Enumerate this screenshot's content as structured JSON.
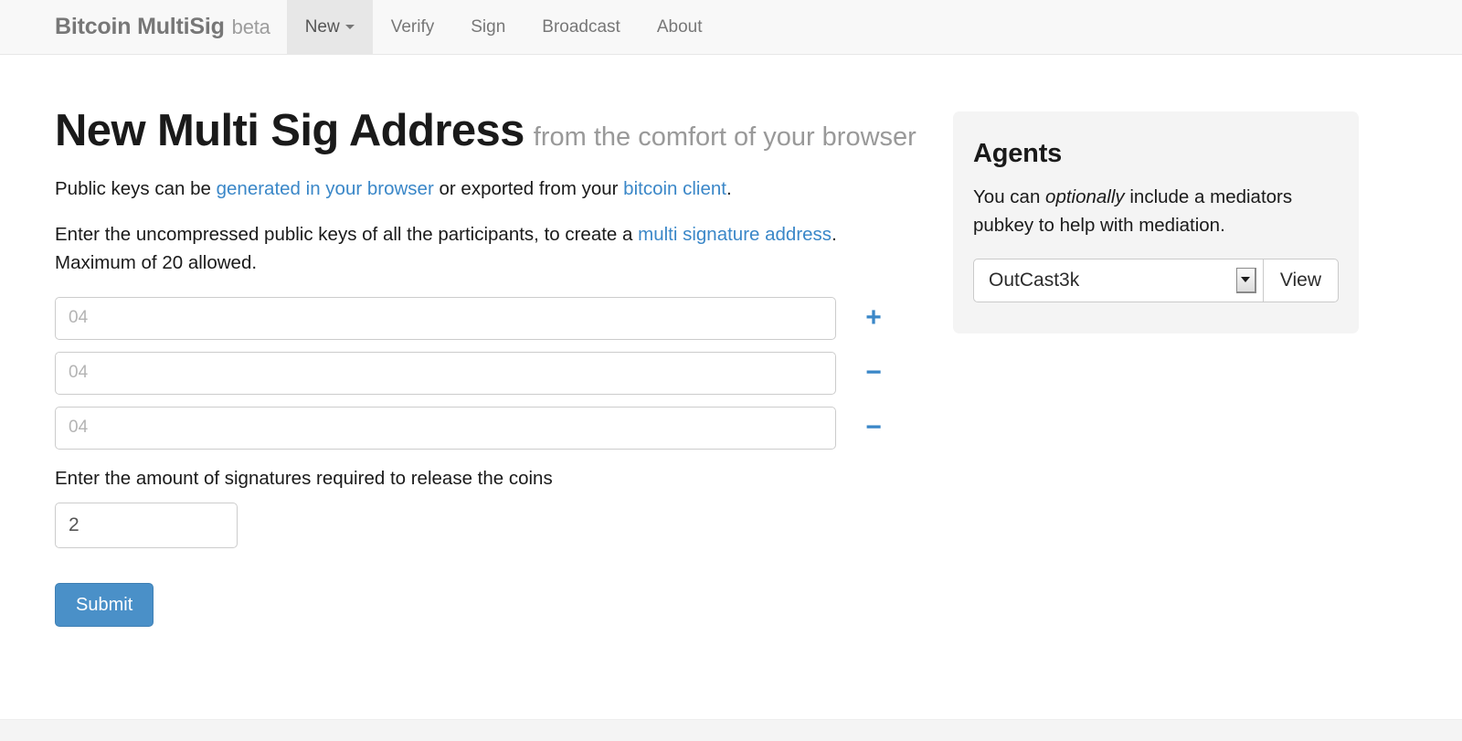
{
  "navbar": {
    "brand": {
      "name": "Bitcoin MultiSig",
      "tag": "beta"
    },
    "items": [
      {
        "label": "New",
        "active": true,
        "caret": true
      },
      {
        "label": "Verify",
        "active": false,
        "caret": false
      },
      {
        "label": "Sign",
        "active": false,
        "caret": false
      },
      {
        "label": "Broadcast",
        "active": false,
        "caret": false
      },
      {
        "label": "About",
        "active": false,
        "caret": false
      }
    ]
  },
  "main": {
    "heading": "New Multi Sig Address",
    "heading_sub": "from the comfort of your browser",
    "intro": {
      "part1": "Public keys can be ",
      "link1": "generated in your browser",
      "part2": " or exported from your ",
      "link2": "bitcoin client",
      "part3": "."
    },
    "instructions": {
      "part1": "Enter the uncompressed public keys of all the participants, to create a ",
      "link1": "multi signature address",
      "part2": ". Maximum of 20 allowed."
    },
    "key_rows": [
      {
        "value": "",
        "placeholder": "04",
        "button": "+",
        "button_name": "add-key-button"
      },
      {
        "value": "",
        "placeholder": "04",
        "button": "−",
        "button_name": "remove-key-button"
      },
      {
        "value": "",
        "placeholder": "04",
        "button": "−",
        "button_name": "remove-key-button"
      }
    ],
    "signatures_label": "Enter the amount of signatures required to release the coins",
    "signatures_value": "2",
    "signatures_placeholder": "",
    "submit_label": "Submit"
  },
  "sidebar": {
    "title": "Agents",
    "description": {
      "part1": "You can ",
      "emphasis": "optionally",
      "part2": " include a mediators pubkey to help with mediation."
    },
    "agent_selected": "OutCast3k",
    "view_label": "View"
  },
  "colors": {
    "link": "#3a87c8",
    "primary_button": "#4a90c8",
    "navbar_bg": "#f8f8f8",
    "navbar_active_bg": "#e7e7e7",
    "panel_bg": "#f4f4f4",
    "muted_text": "#999999"
  }
}
